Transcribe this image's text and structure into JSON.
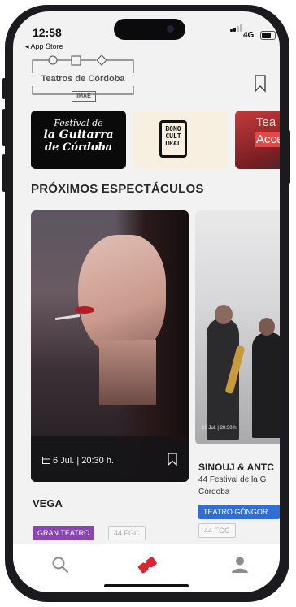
{
  "status_bar": {
    "time": "12:58",
    "back_app": "◂ App Store",
    "network": "4G"
  },
  "header": {
    "logo_title": "Teatros de Córdoba",
    "logo_subtitle": "IMAE",
    "bookmark_icon": "bookmark-icon"
  },
  "carousel": {
    "tiles": [
      {
        "lines": [
          "Festival de",
          "la Guitarra",
          "de Córdoba"
        ],
        "bg": "#0a0a0a"
      },
      {
        "lines": [
          "BONO",
          "CULT",
          "URAL"
        ],
        "bg": "#f7f0e1"
      },
      {
        "lines": [
          "Tea",
          "Acce"
        ],
        "bg": "#c43b3b"
      }
    ]
  },
  "section_title": "PRÓXIMOS ESPECTÁCULOS",
  "shows": [
    {
      "date": "6 Jul. | 20:30 h.",
      "title": "VEGA",
      "tags": [
        "GRAN TEATRO",
        "44 FGC"
      ]
    },
    {
      "date": "10 Jul. | 20:30 h.",
      "title": "SINOUJ & ANTC",
      "subtitle_line1": "44 Festival de la G",
      "subtitle_line2": "Córdoba",
      "tags": [
        "TEATRO GÓNGOR",
        "44 FGC"
      ]
    }
  ],
  "tabbar": {
    "items": [
      "search-icon",
      "ticket-icon",
      "profile-icon"
    ],
    "active_color": "#e0222c",
    "inactive_color": "#8c8c8c"
  },
  "colors": {
    "tag_purple": "#8a45b4",
    "tag_blue": "#2f6fd1",
    "accent_red": "#e0222c"
  }
}
